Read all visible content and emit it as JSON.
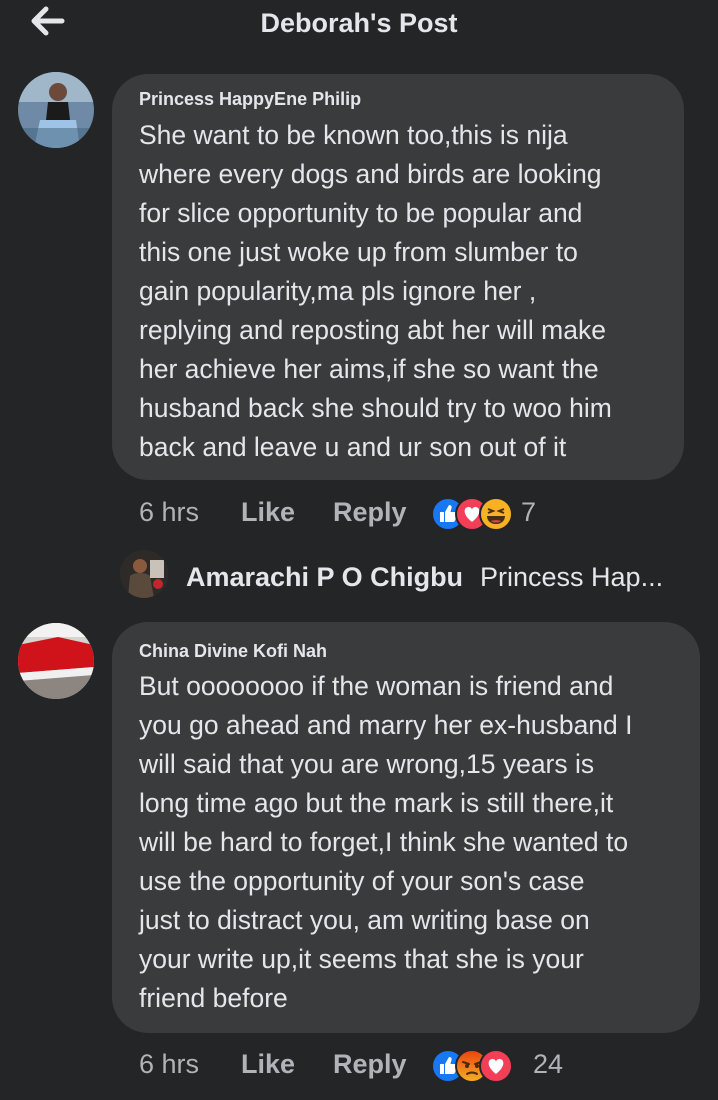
{
  "header": {
    "title": "Deborah's Post",
    "back_icon": "arrow-left-icon"
  },
  "comments": [
    {
      "author": "Princess HappyEne Philip",
      "lines": [
        "She want to be known too,this is nija",
        "where every dogs and birds are looking",
        "for slice opportunity to be popular and",
        "this one just woke up from slumber to",
        "gain popularity,ma pls ignore her ,",
        "replying and reposting abt her will make",
        "her achieve her aims,if she so want the",
        "husband back she should try to woo him",
        "back and leave u and ur son out of it"
      ],
      "time": "6 hrs",
      "like": "Like",
      "reply": "Reply",
      "reactions": [
        "like-reaction-icon",
        "love-reaction-icon",
        "haha-reaction-icon"
      ],
      "reaction_count": "7"
    },
    {
      "author": "China Divine Kofi Nah",
      "lines": [
        "But oooooooo if the woman is friend and",
        "you go ahead and marry her ex-husband I",
        "will said that you are wrong,15 years is",
        "long time ago but the mark is still there,it",
        "will be hard to forget,I think she wanted to",
        "use the opportunity of your son's case",
        "just to distract you, am writing base on",
        "your write up,it seems that she is your",
        "friend before"
      ],
      "time": "6 hrs",
      "like": "Like",
      "reply": "Reply",
      "reactions": [
        "like-reaction-icon",
        "angry-reaction-icon",
        "love-reaction-icon"
      ],
      "reaction_count": "24"
    }
  ],
  "reply_preview": {
    "name": "Amarachi P O Chigbu",
    "snippet": "Princess Hap..."
  },
  "colors": {
    "background": "#242526",
    "bubble": "#3a3b3c",
    "text": "#e4e6eb",
    "secondary_text": "#b0b3b8",
    "like_blue": "#1877f2",
    "love_red": "#f33e58",
    "haha_yellow": "#f7b125",
    "angry_orange": "#e9710f"
  }
}
